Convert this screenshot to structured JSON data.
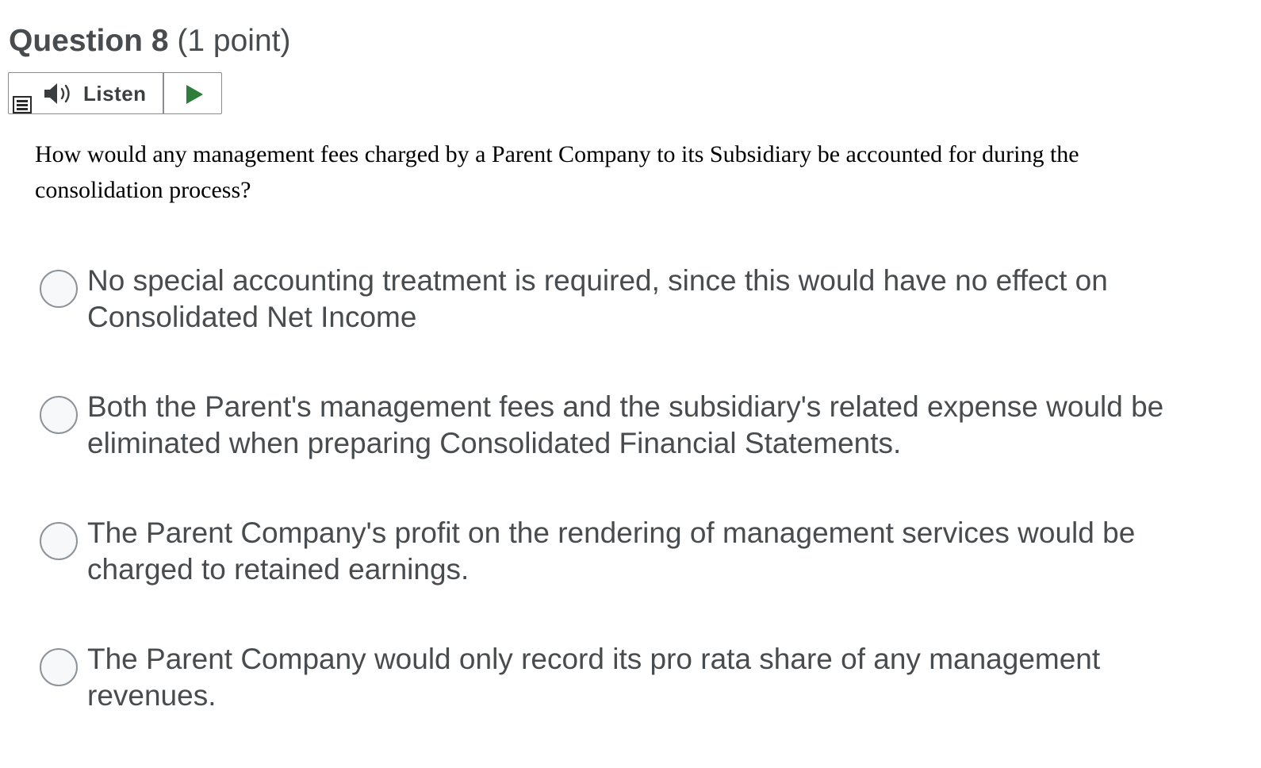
{
  "question": {
    "title": "Question 8",
    "points": "(1 point)",
    "text": "How would any management fees charged by a Parent Company to its Subsidiary be accounted for during the consolidation process?"
  },
  "listen_bar": {
    "listen_label": "Listen",
    "menu_icon": "menu-icon",
    "speaker_icon": "speaker-icon",
    "play_icon": "play-icon",
    "play_color": "#2e7d3a"
  },
  "options": [
    {
      "label": "No special accounting treatment is required, since this would have no effect on Consolidated Net Income",
      "selected": false
    },
    {
      "label": "Both the Parent's management fees and the subsidiary's related expense would be eliminated when preparing Consolidated Financial Statements.",
      "selected": false
    },
    {
      "label": "The Parent Company's profit on the rendering of management services would be charged to retained earnings.",
      "selected": false
    },
    {
      "label": "The Parent Company would only record its pro rata share of any management revenues.",
      "selected": false
    }
  ]
}
